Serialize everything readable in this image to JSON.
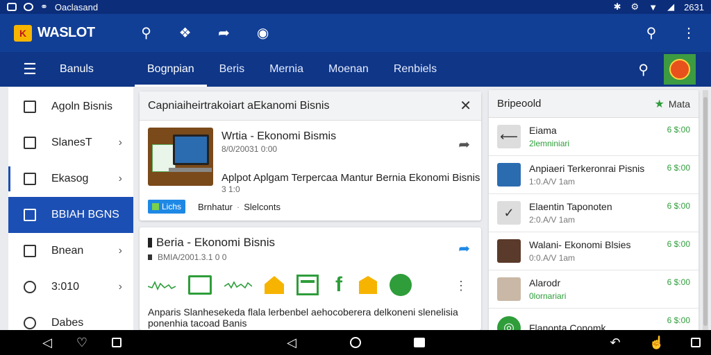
{
  "status_bar": {
    "app_label": "Oaclasand",
    "time": "2631"
  },
  "app_bar": {
    "brand": "WASLOT",
    "logo_text": "K"
  },
  "tab_bar": {
    "title": "Banuls",
    "tabs": [
      {
        "label": "Bognpian",
        "active": true
      },
      {
        "label": "Beris",
        "active": false
      },
      {
        "label": "Mernia",
        "active": false
      },
      {
        "label": "Moenan",
        "active": false
      },
      {
        "label": "Renbiels",
        "active": false
      }
    ]
  },
  "sidebar": {
    "items": [
      {
        "label": "Agoln Bisnis",
        "chevron": false
      },
      {
        "label": "SlanesT",
        "chevron": true
      },
      {
        "label": "Ekasog",
        "chevron": true
      },
      {
        "label": "BBIAH BGNS",
        "chevron": false,
        "active": true
      },
      {
        "label": "Bnean",
        "chevron": true
      },
      {
        "label": "3:010",
        "chevron": true
      },
      {
        "label": "Dabes",
        "chevron": false
      }
    ]
  },
  "card1": {
    "header": "Capniaiheirtrakoiart aEkanomi Bisnis",
    "title": "Wrtia - Ekonomi Bismis",
    "date": "8/0/20031 0:00",
    "description": "Aplpot   Aplgam Terpercaa Mantur Bernia Ekonomi Bisnis",
    "date2": "3 1:0",
    "badge": "Lichs",
    "footer_left": "Brnhatur",
    "footer_sep": "·",
    "footer_right": "Slelconts"
  },
  "card2": {
    "title": "Beria - Ekonomi Bisnis",
    "date": "BMIA/2001.3.1 0 0",
    "description": "Anparis Slanhesekeda flala lerbenbel aehocoberera delkoneni slenelisia ponenhia tacoad Banis"
  },
  "right_panel": {
    "header": "Bripeoold",
    "more_label": "Mata",
    "items": [
      {
        "title": "Eiama",
        "sub": "2lemniniari",
        "sub_green": true,
        "price": "6 $:00",
        "thumb": "arrow"
      },
      {
        "title": "Anpiaeri Terkeronrai Pisnis",
        "sub": "1:0.A/V 1am",
        "sub_green": false,
        "price": "6 $:00",
        "thumb": "blue"
      },
      {
        "title": "Elaentin Taponoten",
        "sub": "2:0.A/V 1am",
        "sub_green": false,
        "price": "6 $:00",
        "thumb": "check"
      },
      {
        "title": "Walani- Ekonomi Blsies",
        "sub": "0:0.A/V 1am",
        "sub_green": false,
        "price": "6 $:00",
        "thumb": "dark"
      },
      {
        "title": "Alarodr",
        "sub": "0lornariari",
        "sub_green": true,
        "price": "6 $:00",
        "thumb": "person"
      },
      {
        "title": "Flanonta Conomk",
        "sub": "",
        "sub_green": false,
        "price": "6 $:00",
        "thumb": "green"
      }
    ]
  },
  "colors": {
    "app_bar": "#123f96",
    "tab_bar": "#0f3687",
    "accent_blue": "#1b4fb3",
    "accent_green": "#2e9d3a"
  }
}
